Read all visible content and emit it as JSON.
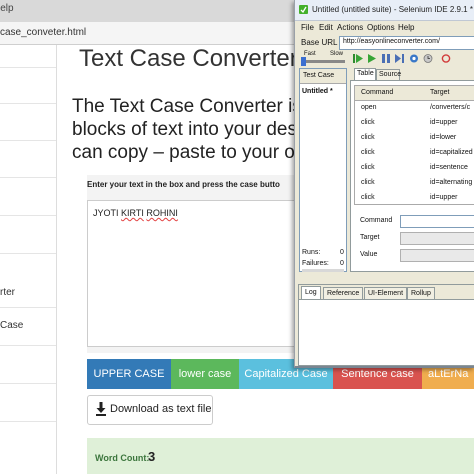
{
  "browser": {
    "title_fragment": "lelp",
    "url_fragment": "case_conveter.html"
  },
  "site": {
    "sidebar": {
      "converter_label": "rter",
      "case_label": "Case"
    },
    "page_heading": "Text Case Converter",
    "intro_lines": [
      "The Text Case Converter is S",
      "blocks of text into your desira",
      "can copy – paste to your own"
    ],
    "editor_instruction": "Enter your text in the box and press the case butto",
    "input_value": {
      "word_1": "JYOTI",
      "word_2": "KIRTI",
      "word_3": "ROHINI"
    },
    "case_buttons": {
      "upper": "UPPER CASE",
      "lower": "lower case",
      "capitalized": "Capitalized Case",
      "sentence": "Sentence case",
      "alternating": "aLtErNa"
    },
    "download_label": "Download as text file",
    "word_count_label": "Word Count:",
    "word_count_value": "3"
  },
  "ide": {
    "title": "Untitled (untitled suite) - Selenium IDE 2.9.1 *",
    "menu": [
      "File",
      "Edit",
      "Actions",
      "Options",
      "Help"
    ],
    "base_url_label": "Base URL",
    "base_url_value": "http://easyonlineconverter.com/",
    "speed_fast": "Fast",
    "speed_slow": "Slow",
    "test_case_header": "Test Case",
    "test_case_item": "Untitled *",
    "runs_label": "Runs:",
    "runs_count": "0",
    "failures_label": "Failures:",
    "failures_count": "0",
    "tabs": {
      "table": "Table",
      "source": "Source"
    },
    "columns": {
      "command": "Command",
      "target": "Target"
    },
    "commands": [
      {
        "command": "open",
        "target": "/converters/c"
      },
      {
        "command": "click",
        "target": "id=upper"
      },
      {
        "command": "click",
        "target": "id=lower"
      },
      {
        "command": "click",
        "target": "id=capitalized"
      },
      {
        "command": "click",
        "target": "id=sentence"
      },
      {
        "command": "click",
        "target": "id=alternating"
      },
      {
        "command": "click",
        "target": "id=upper"
      }
    ],
    "form": {
      "command_label": "Command",
      "target_label": "Target",
      "value_label": "Value"
    },
    "log_tabs": [
      "Log",
      "Reference",
      "UI-Element",
      "Rollup"
    ]
  }
}
